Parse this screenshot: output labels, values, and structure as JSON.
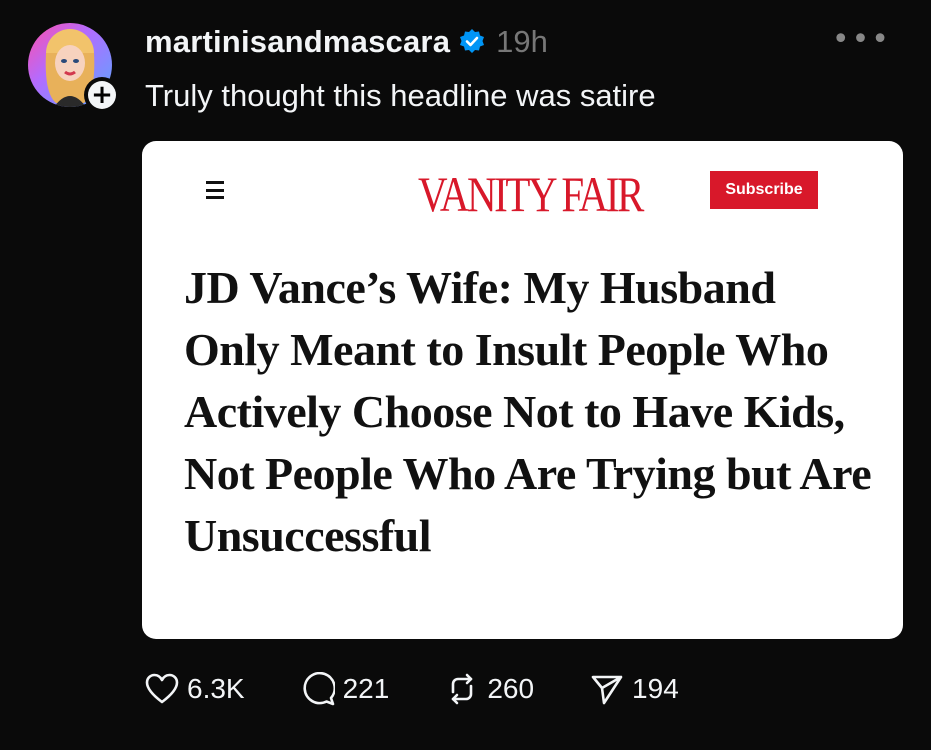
{
  "post": {
    "username": "martinisandmascara",
    "time": "19h",
    "text": "Truly thought this headline was satire",
    "more_icon": "more-icon",
    "verified_icon": "verified-badge-icon",
    "follow_icon": "plus-icon"
  },
  "embed": {
    "logo": "VANITY FAIR",
    "subscribe": "Subscribe",
    "headline": "JD Vance’s Wife: My Husband Only Meant to Insult People Who Actively Choose Not to Have Kids, Not People Who Are Trying but Are Unsuccessful",
    "brand_color": "#d8182a"
  },
  "actions": {
    "likes": "6.3K",
    "replies": "221",
    "reposts": "260",
    "shares": "194"
  },
  "colors": {
    "background": "#0a0a0a",
    "text": "#f3f5f7",
    "muted": "#777777",
    "verified": "#0095f6"
  }
}
